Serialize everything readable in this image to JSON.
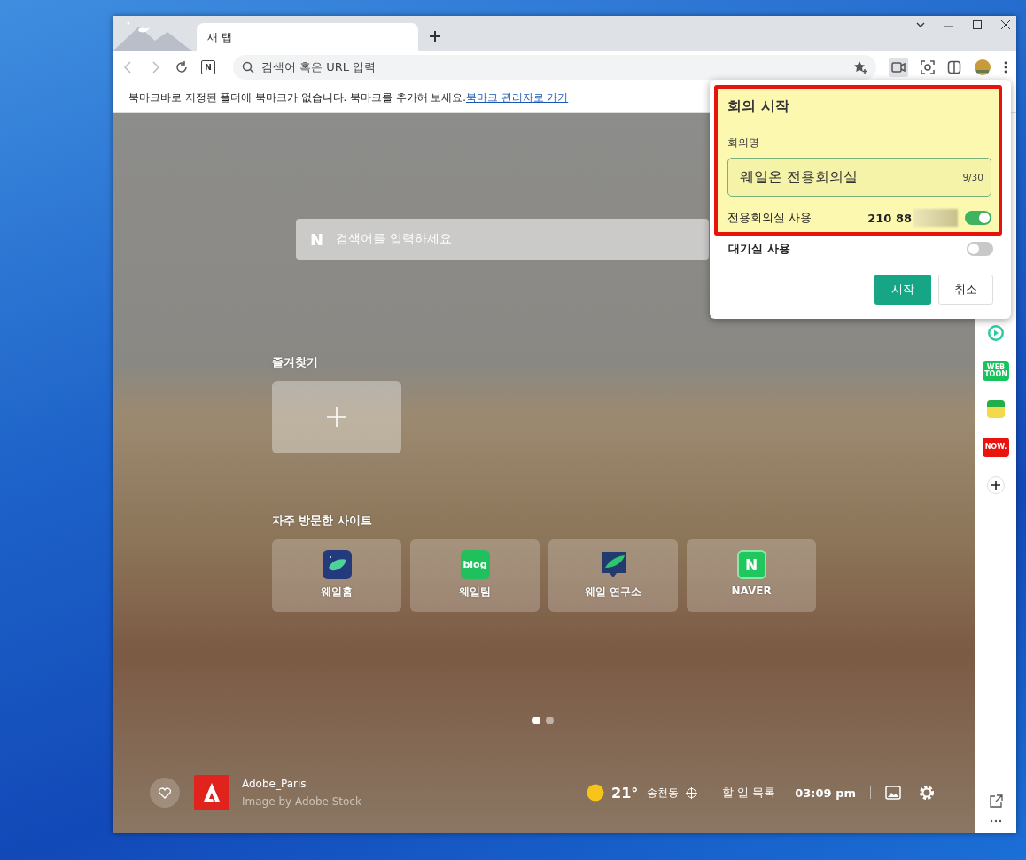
{
  "tabs": [
    {
      "label": "새 탭",
      "selected": true
    }
  ],
  "address_bar": {
    "logo": "N",
    "placeholder": "검색어 혹은 URL 입력"
  },
  "bookmark_bar": {
    "message": "북마크바로 지정된 폴더에 북마크가 없습니다. 북마크를 추가해 보세요.",
    "link": "북마크 관리자로 가기"
  },
  "new_tab": {
    "search_logo": "N",
    "search_placeholder": "검색어를 입력하세요",
    "favorites_title": "즐겨찾기",
    "frequent_title": "자주 방문한 사이트",
    "frequent_sites": [
      {
        "kind": "whale",
        "label": "웨일홈"
      },
      {
        "kind": "blog",
        "icon_text": "blog",
        "label": "웨일팀"
      },
      {
        "kind": "lab",
        "label": "웨일 연구소"
      },
      {
        "kind": "naver",
        "icon_text": "N",
        "label": "NAVER"
      }
    ],
    "page_dots": [
      {
        "selected": true
      },
      {
        "selected": false
      }
    ],
    "image_info": {
      "title": "Adobe_Paris",
      "credit": "Image by Adobe Stock"
    },
    "weather": {
      "temperature": "21°",
      "location": "송천동"
    },
    "todo": "할 일 목록",
    "time": "03:09 pm"
  },
  "sidebar": [
    {
      "kind": "play"
    },
    {
      "kind": "webtoon",
      "text": "WEB TOON"
    },
    {
      "kind": "memo"
    },
    {
      "kind": "now",
      "text": "NOW."
    },
    {
      "kind": "add"
    }
  ],
  "meeting_popup": {
    "title": "회의 시작",
    "name_label": "회의명",
    "name_value": "웨일온 전용회의실",
    "counter": "9/30",
    "toggles": [
      {
        "label": "전용회의실 사용",
        "detail": "210 88",
        "on": true
      },
      {
        "label": "대기실 사용",
        "on": false
      }
    ],
    "start_button": "시작",
    "cancel_button": "취소"
  }
}
